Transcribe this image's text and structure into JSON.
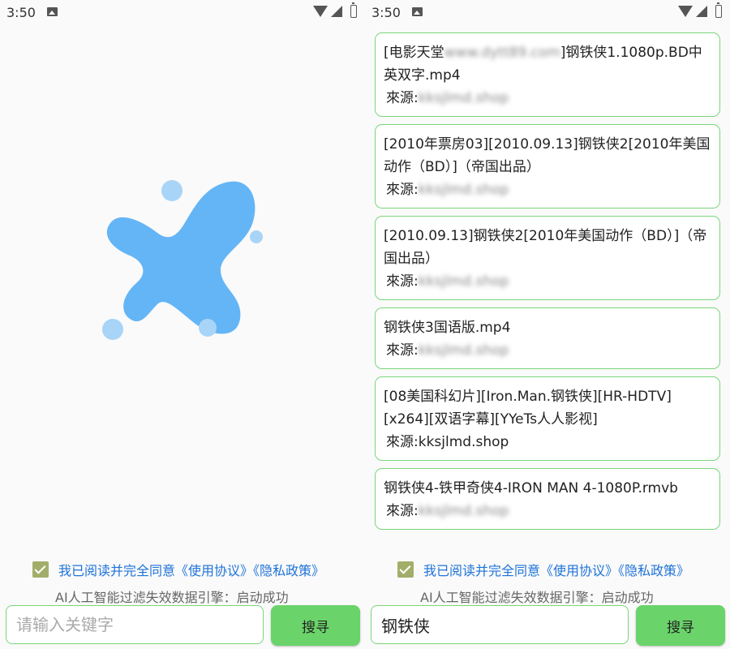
{
  "status_bar": {
    "time": "3:50"
  },
  "left_screen": {
    "agreement": {
      "prefix": "我已阅读并完全同意",
      "terms_link": "《使用协议》",
      "privacy_link": "《隐私政策》"
    },
    "engine_status": "AI人工智能过滤失效数据引擎：启动成功",
    "search": {
      "placeholder": "请输入关键字",
      "value": ""
    },
    "search_button": "搜寻"
  },
  "right_screen": {
    "results": [
      {
        "title_prefix": "[电影天堂",
        "title_blurred": "www.dytt89.com",
        "title_suffix": "]钢铁侠1.1080p.BD中英双字.mp4",
        "source_label": "來源:",
        "source_value": "kksjlmd.shop",
        "source_blurred": true
      },
      {
        "title": "[2010年票房03][2010.09.13]钢铁侠2[2010年美国动作（BD）]（帝国出品）",
        "source_label": "來源:",
        "source_value": "kksjlmd.shop",
        "source_blurred": true
      },
      {
        "title": "[2010.09.13]钢铁侠2[2010年美国动作（BD）]（帝国出品）",
        "source_label": "來源:",
        "source_value": "kksjlmd.shop",
        "source_blurred": true
      },
      {
        "title": "钢铁侠3国语版.mp4",
        "source_label": "來源:",
        "source_value": "kksjlmd.shop",
        "source_blurred": true
      },
      {
        "title": "[08美国科幻片][Iron.Man.钢铁侠][HR-HDTV][x264][双语字幕][YYeTs人人影视]",
        "source_label": "來源:",
        "source_value": "kksjlmd.shop",
        "source_blurred": false
      },
      {
        "title": "钢铁侠4-铁甲奇侠4-IRON MAN 4-1080P.rmvb",
        "source_label": "來源:",
        "source_value": "kksjlmd.shop",
        "source_blurred": true
      }
    ],
    "agreement": {
      "prefix": "我已阅读并完全同意",
      "terms_link": "《使用协议》",
      "privacy_link": "《隐私政策》"
    },
    "engine_status": "AI人工智能过滤失效数据引擎：启动成功",
    "search": {
      "placeholder": "请输入关键字",
      "value": "钢铁侠"
    },
    "search_button": "搜寻"
  },
  "colors": {
    "accent_green": "#6ad46a",
    "border_green": "#7ad67a",
    "link_blue": "#1e73d8",
    "logo_blue": "#64b5f6"
  },
  "icons": [
    "image-icon",
    "wifi-icon",
    "signal-icon",
    "battery-charging-icon",
    "splash-logo"
  ]
}
